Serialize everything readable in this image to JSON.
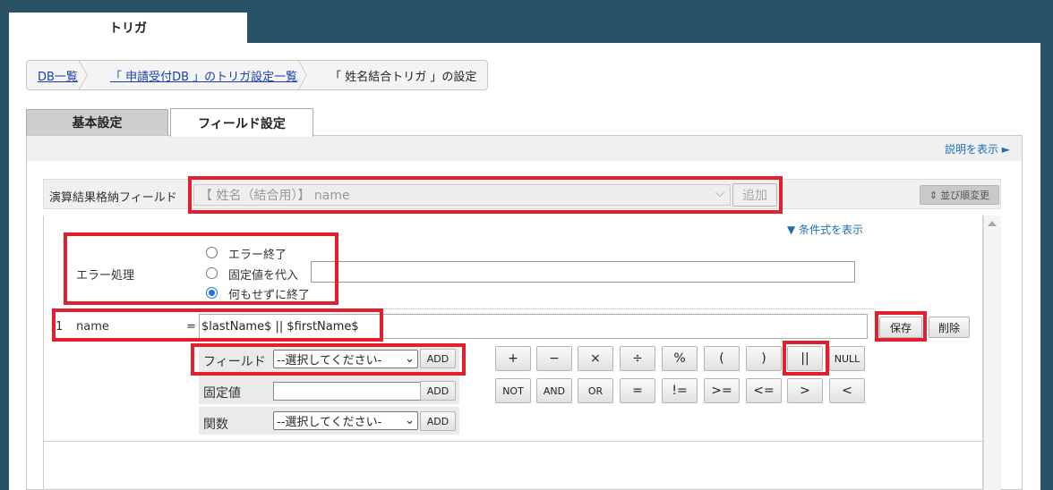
{
  "top_tab": "トリガ",
  "breadcrumb": {
    "db_list": "DB一覧",
    "trigger_list": "「 申請受付DB 」のトリガ設定一覧",
    "current": "「 姓名結合トリガ 」の設定"
  },
  "tabs": {
    "basic": "基本設定",
    "field": "フィールド設定"
  },
  "help_link": "説明を表示 ►",
  "result_field": {
    "label": "演算結果格納フィールド",
    "selected": "【 姓名（結合用）】 name",
    "add_button": "追加",
    "reorder_button": "並び順変更"
  },
  "condition_link": "▼ 条件式を表示",
  "error_handling": {
    "label": "エラー処理",
    "options": [
      "エラー終了",
      "固定値を代入",
      "何もせずに終了"
    ],
    "selected_index": 2,
    "fixed_value": ""
  },
  "formula": {
    "index": "1",
    "field": "name",
    "equals": "=",
    "expression": "$lastName$ || $firstName$",
    "save": "保存",
    "delete": "削除"
  },
  "builder": {
    "field_label": "フィールド",
    "fixed_label": "固定値",
    "func_label": "関数",
    "select_placeholder": "--選択してください-",
    "add": "ADD",
    "fixed_value": ""
  },
  "operators_row1": [
    "+",
    "−",
    "×",
    "÷",
    "%",
    "(",
    ")",
    "||",
    "NULL"
  ],
  "operators_row2": [
    "NOT",
    "AND",
    "OR",
    "=",
    "!=",
    ">=",
    "<=",
    ">",
    "<"
  ]
}
